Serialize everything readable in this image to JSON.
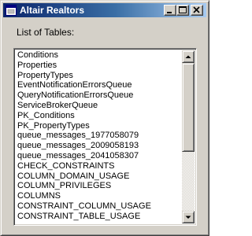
{
  "window": {
    "title": "Altair Realtors",
    "controls": {
      "minimize": "minimize",
      "maximize": "maximize",
      "close": "close"
    }
  },
  "caption": "List of Tables:",
  "tables": [
    "Conditions",
    "Properties",
    "PropertyTypes",
    "EventNotificationErrorsQueue",
    "QueryNotificationErrorsQueue",
    "ServiceBrokerQueue",
    "PK_Conditions",
    "PK_PropertyTypes",
    "queue_messages_1977058079",
    "queue_messages_2009058193",
    "queue_messages_2041058307",
    "CHECK_CONSTRAINTS",
    "COLUMN_DOMAIN_USAGE",
    "COLUMN_PRIVILEGES",
    "COLUMNS",
    "CONSTRAINT_COLUMN_USAGE",
    "CONSTRAINT_TABLE_USAGE"
  ],
  "scrollbar": {
    "position_fraction": 0.0,
    "visible_fraction": 0.6
  },
  "colors": {
    "titlebar_start": "#0a246a",
    "titlebar_end": "#a6caf0",
    "face": "#d4d0c8"
  },
  "icons": {
    "app": "window-app-icon",
    "minimize": "minimize-icon",
    "maximize": "maximize-icon",
    "close": "close-icon",
    "scroll_up": "scroll-up-arrow-icon",
    "scroll_down": "scroll-down-arrow-icon"
  }
}
